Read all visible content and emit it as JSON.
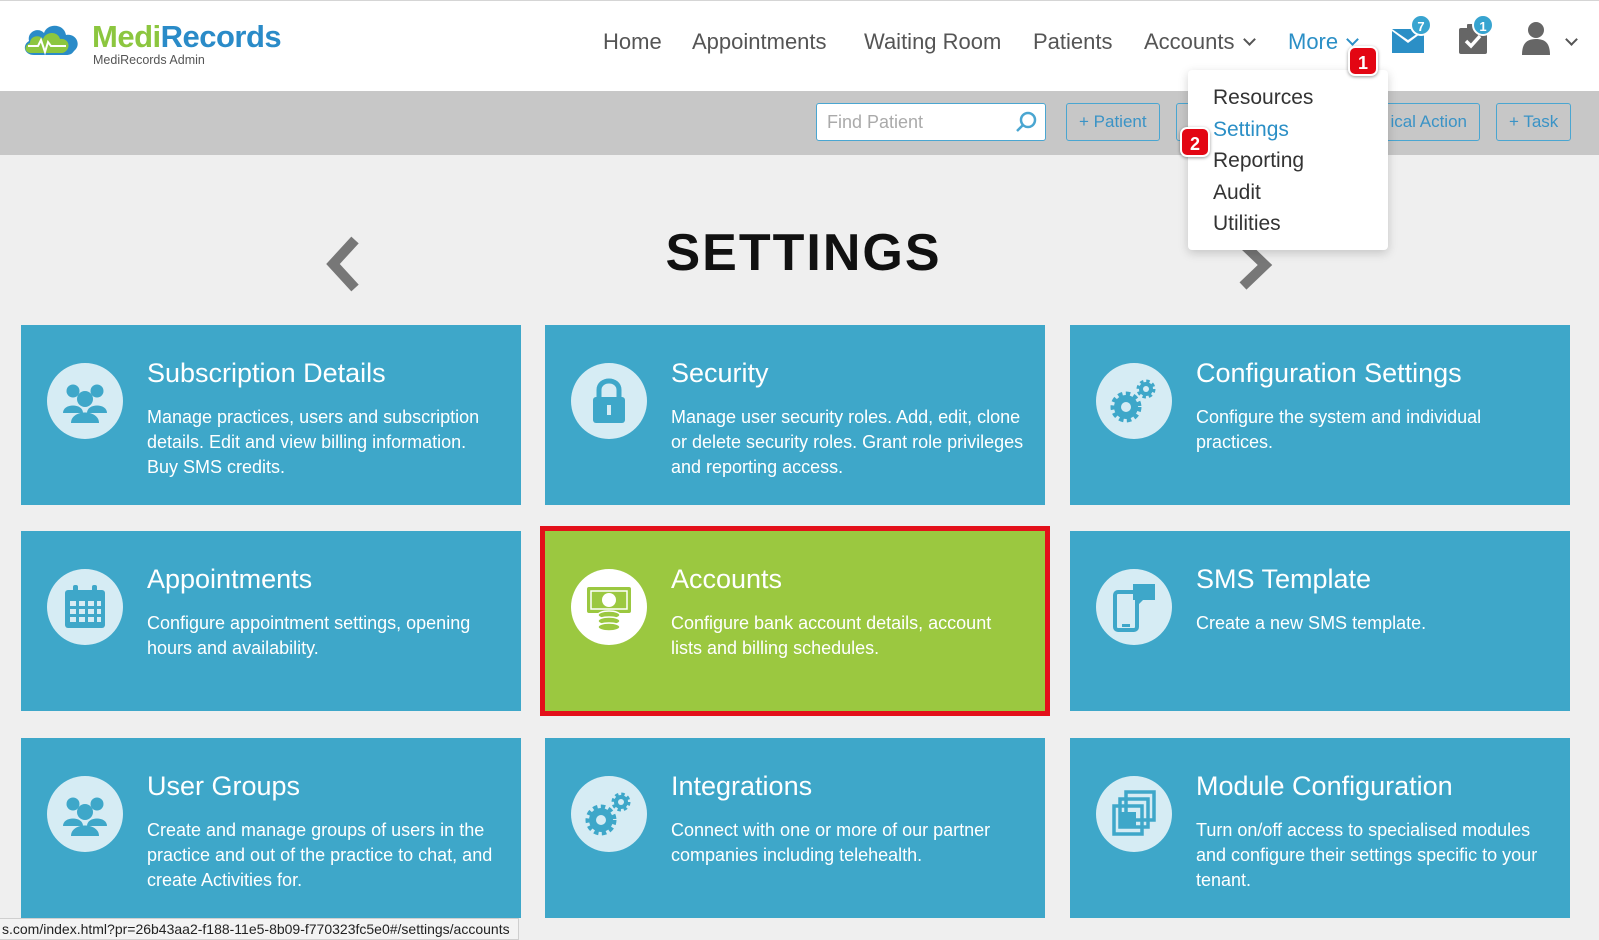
{
  "brand": {
    "name_part1": "Medi",
    "name_part2": "Records",
    "subtitle": "MediRecords Admin"
  },
  "nav": {
    "items": [
      {
        "label": "Home"
      },
      {
        "label": "Appointments"
      },
      {
        "label": "Waiting Room"
      },
      {
        "label": "Patients"
      },
      {
        "label": "Accounts"
      },
      {
        "label": "More"
      }
    ],
    "mail_count": "7",
    "tasks_count": "1"
  },
  "dropdown": {
    "items": [
      {
        "label": "Resources"
      },
      {
        "label": "Settings"
      },
      {
        "label": "Reporting"
      },
      {
        "label": "Audit"
      },
      {
        "label": "Utilities"
      }
    ]
  },
  "steps": {
    "one": "1",
    "two": "2"
  },
  "toolbar": {
    "search_placeholder": "Find Patient",
    "patient_button": "+ Patient",
    "clinical_action_button": "ical Action",
    "task_button": "+ Task"
  },
  "page": {
    "title": "SETTINGS"
  },
  "tiles": [
    {
      "title": "Subscription Details",
      "description": "Manage practices, users and subscription details. Edit and view billing information. Buy SMS credits.",
      "icon": "users-icon"
    },
    {
      "title": "Security",
      "description": "Manage user security roles. Add, edit, clone or delete security roles. Grant role privileges and reporting access.",
      "icon": "lock-icon"
    },
    {
      "title": "Configuration Settings",
      "description": "Configure the system and individual practices.",
      "icon": "gears-icon"
    },
    {
      "title": "Appointments",
      "description": "Configure appointment settings, opening hours and availability.",
      "icon": "calendar-icon"
    },
    {
      "title": "Accounts",
      "description": "Configure bank account details, account lists and billing schedules.",
      "icon": "money-icon"
    },
    {
      "title": "SMS Template",
      "description": "Create a new SMS template.",
      "icon": "phone-message-icon"
    },
    {
      "title": "User Groups",
      "description": "Create and manage groups of users in the practice and out of the practice to chat, and create Activities for.",
      "icon": "users-icon"
    },
    {
      "title": "Integrations",
      "description": "Connect with one or more of our partner companies including telehealth.",
      "icon": "gears-icon"
    },
    {
      "title": "Module Configuration",
      "description": "Turn on/off access to specialised modules and configure their settings specific to your tenant.",
      "icon": "modules-icon"
    }
  ],
  "status_url": "s.com/index.html?pr=26b43aa2-f188-11e5-8b09-f770323fc5e0#/settings/accounts",
  "colors": {
    "tile": "#3ea7c9",
    "highlight_tile": "#9bc840",
    "highlight_border": "#e3101a",
    "brand_green": "#8cc63f",
    "brand_blue": "#2a8bc8",
    "nav_active": "#2b8fc6"
  }
}
